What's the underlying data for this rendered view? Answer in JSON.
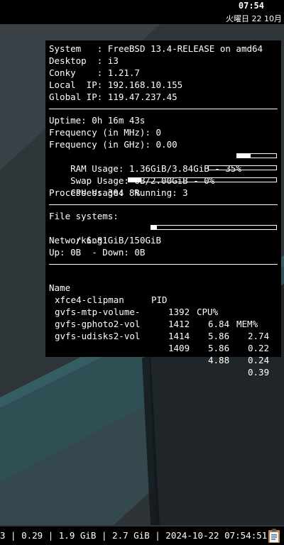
{
  "topbar": {
    "time": "07:54",
    "date": "火曜日 22 10月"
  },
  "conky": {
    "system_label": "System   : ",
    "system_value": "FreeBSD 13.4-RELEASE on amd64",
    "desktop_label": "Desktop  : ",
    "desktop_value": "i3",
    "conky_label": "Conky    : ",
    "conky_value": "1.21.7",
    "local_ip_label": "Local  IP: ",
    "local_ip_value": "192.168.10.155",
    "global_ip_label": "Global IP: ",
    "global_ip_value": "119.47.237.45",
    "uptime": "Uptime: 0h 16m 43s",
    "freq_mhz": "Frequency (in MHz): 0",
    "freq_ghz": "Frequency (in GHz): 0.00",
    "ram": "RAM Usage: 1.36GiB/3.84GiB - 35%",
    "ram_fraction": 0.35,
    "swap": "Swap Usage: 0B/2.00GiB - 0%",
    "swap_fraction": 0.0,
    "cpu": "CPU Usage: 8%",
    "cpu_fraction": 0.08,
    "processes": "Processes: 304  Running: 3",
    "fs_header": "File systems:",
    "fs_root": " / 6.81GiB/150GiB",
    "fs_fraction": 0.045,
    "net_header": "Networking:",
    "net_updown": "Up: 0B  - Down: 0B",
    "proc_headers": {
      "name": "Name",
      "pid": "PID",
      "cpu": "CPU%",
      "mem": "MEM%"
    },
    "procs": [
      {
        "name": "xfce4-clipman",
        "pid": "1392",
        "cpu": "6.84",
        "mem": "2.74"
      },
      {
        "name": "gvfs-mtp-volume-",
        "pid": "1412",
        "cpu": "5.86",
        "mem": "0.22"
      },
      {
        "name": "gvfs-gphoto2-vol",
        "pid": "1414",
        "cpu": "5.86",
        "mem": "0.24"
      },
      {
        "name": "gvfs-udisks2-vol",
        "pid": "1409",
        "cpu": "4.88",
        "mem": "0.39"
      }
    ]
  },
  "statusbar": {
    "text": "3 | 0.29 | 1.9 GiB | 2.7 GiB | 2024-10-22 07:54:51"
  },
  "icons": {
    "tray": "clipboard-icon"
  }
}
